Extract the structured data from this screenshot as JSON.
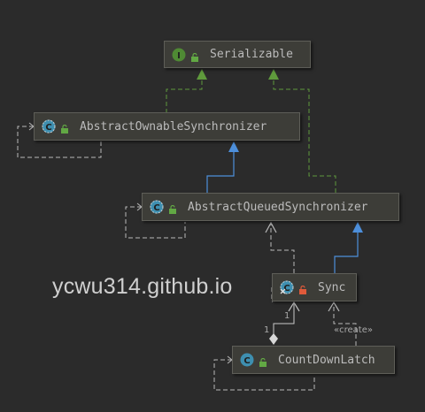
{
  "nodes": {
    "serializable": {
      "name": "Serializable",
      "kind": "interface",
      "badge": "I",
      "access": "public"
    },
    "aos": {
      "name": "AbstractOwnableSynchronizer",
      "kind": "abstract-class",
      "badge": "C",
      "access": "public"
    },
    "aqs": {
      "name": "AbstractQueuedSynchronizer",
      "kind": "abstract-class",
      "badge": "C",
      "access": "public"
    },
    "sync": {
      "name": "Sync",
      "kind": "abstract-inner-class",
      "badge": "C",
      "access": "private"
    },
    "cdl": {
      "name": "CountDownLatch",
      "kind": "class",
      "badge": "C",
      "access": "public"
    }
  },
  "edges": [
    {
      "from": "AbstractOwnableSynchronizer",
      "to": "Serializable",
      "type": "implements"
    },
    {
      "from": "AbstractQueuedSynchronizer",
      "to": "Serializable",
      "type": "implements"
    },
    {
      "from": "AbstractQueuedSynchronizer",
      "to": "AbstractOwnableSynchronizer",
      "type": "extends"
    },
    {
      "from": "Sync",
      "to": "AbstractQueuedSynchronizer",
      "type": "extends"
    },
    {
      "from": "Sync",
      "to": "AbstractQueuedSynchronizer",
      "type": "dependency"
    },
    {
      "from": "CountDownLatch",
      "to": "Sync",
      "type": "composition",
      "multiplicity_source": "1",
      "multiplicity_target": "1"
    },
    {
      "from": "CountDownLatch",
      "to": "Sync",
      "type": "create",
      "label": "«create»"
    }
  ],
  "labels": {
    "multiplicity_a": "1",
    "multiplicity_b": "1",
    "create": "«create»"
  },
  "watermark": "ycwu314.github.io",
  "colors": {
    "background": "#2b2b2b",
    "node_fill": "#3d3d38",
    "interface_badge": "#4f8a34",
    "class_badge": "#3e8fb0",
    "implements_edge": "#5f9a3c",
    "extends_edge": "#4d8fdb",
    "dependency_edge": "#b8b8b8",
    "public_lock": "#62a844",
    "private_lock": "#e05a3a"
  }
}
